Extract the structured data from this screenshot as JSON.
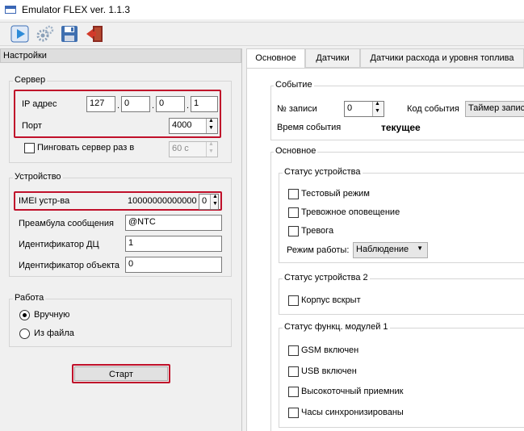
{
  "window": {
    "title": "Emulator FLEX   ver. 1.1.3"
  },
  "toolbar": {
    "icons": [
      "play-icon",
      "gears-icon",
      "save-icon",
      "exit-icon"
    ]
  },
  "settings": {
    "header": "Настройки",
    "server": {
      "group_label": "Сервер",
      "ip_label": "IP адрес",
      "ip": [
        "127",
        "0",
        "0",
        "1"
      ],
      "port_label": "Порт",
      "port": "4000",
      "ping_label": "Пинговать сервер раз в",
      "ping_value": "60 с"
    },
    "device": {
      "group_label": "Устройство",
      "imei_label": "IMEI устр-ва",
      "imei_value": "100000000000000",
      "imei_spin": "0",
      "preamble_label": "Преамбула сообщения",
      "preamble_value": "@NTC",
      "dc_id_label": "Идентификатор ДЦ",
      "dc_id_value": "1",
      "obj_id_label": "Идентификатор объекта",
      "obj_id_value": "0"
    },
    "work": {
      "group_label": "Работа",
      "manual_label": "Вручную",
      "file_label": "Из файла",
      "selected": "manual"
    },
    "start_label": "Старт"
  },
  "tabs": [
    "Основное",
    "Датчики",
    "Датчики расхода и уровня топлива"
  ],
  "main": {
    "event": {
      "group_label": "Событие",
      "record_label": "№ записи",
      "record_value": "0",
      "event_code_label": "Код события",
      "event_code_value": "Таймер записи",
      "event_time_label": "Время события",
      "event_time_value": "текущее"
    },
    "basic": {
      "group_label": "Основное",
      "status": {
        "label": "Статус устройства",
        "items": [
          "Тестовый режим",
          "Тревожное оповещение",
          "Тревога"
        ],
        "mode_label": "Режим работы:",
        "mode_value": "Наблюдение"
      },
      "status2": {
        "label": "Статус устройства 2",
        "items": [
          "Корпус вскрыт"
        ]
      },
      "modules": {
        "label": "Статус функц. модулей 1",
        "items": [
          "GSM включен",
          "USB включен",
          "Высокоточный приемник",
          "Часы синхронизированы"
        ]
      }
    }
  }
}
